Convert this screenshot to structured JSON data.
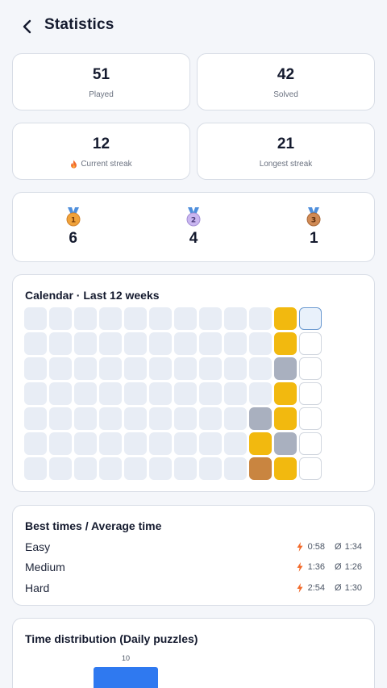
{
  "header": {
    "title": "Statistics",
    "back_icon": "chevron-left-icon"
  },
  "stats": {
    "played": {
      "value": "51",
      "label": "Played"
    },
    "solved": {
      "value": "42",
      "label": "Solved"
    },
    "current_streak": {
      "value": "12",
      "label": "Current streak",
      "icon": "fire-icon"
    },
    "longest_streak": {
      "value": "21",
      "label": "Longest streak"
    }
  },
  "medals": [
    {
      "rank": "1",
      "count": "6",
      "color": "#f0a23a"
    },
    {
      "rank": "2",
      "count": "4",
      "color": "#c9b6f0"
    },
    {
      "rank": "3",
      "count": "1",
      "color": "#d08a55"
    }
  ],
  "calendar": {
    "title": "Calendar · Last 12 weeks",
    "weeks": 12,
    "days": 7,
    "colors": {
      "empty_past": "#e8edf5",
      "solved": "#f2b90f",
      "unsolved": "#a9b0bf",
      "bronze": "#c98540"
    },
    "marked": [
      {
        "week": 10,
        "day": 0,
        "status": "solved"
      },
      {
        "week": 10,
        "day": 1,
        "status": "solved"
      },
      {
        "week": 10,
        "day": 2,
        "status": "gray"
      },
      {
        "week": 10,
        "day": 3,
        "status": "solved"
      },
      {
        "week": 10,
        "day": 4,
        "status": "solved"
      },
      {
        "week": 10,
        "day": 5,
        "status": "gray"
      },
      {
        "week": 10,
        "day": 6,
        "status": "solved"
      },
      {
        "week": 9,
        "day": 4,
        "status": "gray"
      },
      {
        "week": 9,
        "day": 5,
        "status": "solved"
      },
      {
        "week": 9,
        "day": 6,
        "status": "bronze"
      },
      {
        "week": 11,
        "day": 0,
        "status": "today"
      },
      {
        "week": 11,
        "day": 1,
        "status": "empty"
      },
      {
        "week": 11,
        "day": 2,
        "status": "empty"
      },
      {
        "week": 11,
        "day": 3,
        "status": "empty"
      },
      {
        "week": 11,
        "day": 4,
        "status": "empty"
      },
      {
        "week": 11,
        "day": 5,
        "status": "empty"
      },
      {
        "week": 11,
        "day": 6,
        "status": "empty"
      }
    ]
  },
  "times": {
    "title": "Best times / Average time",
    "rows": [
      {
        "level": "Easy",
        "best": "0:58",
        "avg": "1:34"
      },
      {
        "level": "Medium",
        "best": "1:36",
        "avg": "1:26"
      },
      {
        "level": "Hard",
        "best": "2:54",
        "avg": "1:30"
      }
    ],
    "best_icon": "lightning-icon",
    "avg_symbol": "Ø"
  },
  "distribution": {
    "title": "Time distribution (Daily puzzles)",
    "accent": "#2f79f0",
    "chart_data": {
      "type": "bar",
      "categories": [
        ""
      ],
      "values": [
        10
      ],
      "data_labels": [
        "10"
      ],
      "title": "Time distribution (Daily puzzles)"
    }
  }
}
